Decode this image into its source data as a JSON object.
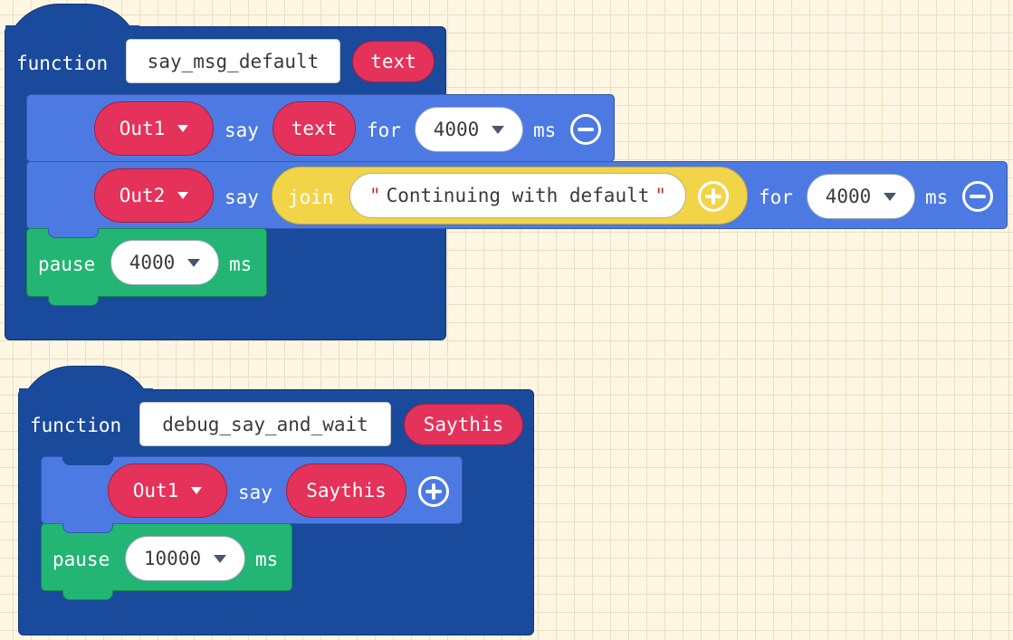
{
  "blocks": {
    "function1": {
      "keyword": "function",
      "name": "say_msg_default",
      "param": "text",
      "say1": {
        "target": "Out1",
        "say_label": "say",
        "value": "text",
        "for_label": "for",
        "duration": "4000",
        "unit": "ms"
      },
      "say2": {
        "target": "Out2",
        "say_label": "say",
        "join_label": "join",
        "join_string": "Continuing with default",
        "for_label": "for",
        "duration": "4000",
        "unit": "ms"
      },
      "pause": {
        "label": "pause",
        "duration": "4000",
        "unit": "ms"
      }
    },
    "function2": {
      "keyword": "function",
      "name": "debug_say_and_wait",
      "param": "Saythis",
      "say": {
        "target": "Out1",
        "say_label": "say",
        "value": "Saythis"
      },
      "pause": {
        "label": "pause",
        "duration": "10000",
        "unit": "ms"
      }
    }
  },
  "icons": [
    "minus-circle-icon",
    "plus-circle-icon",
    "dropdown-caret-icon"
  ],
  "colors": {
    "function_block": "#1a4a9c",
    "statement_block": "#4c7ae2",
    "pause_block": "#22b573",
    "variable_pill": "#e4325a",
    "join_block": "#f2d449",
    "workspace": "#fdf6e3"
  }
}
